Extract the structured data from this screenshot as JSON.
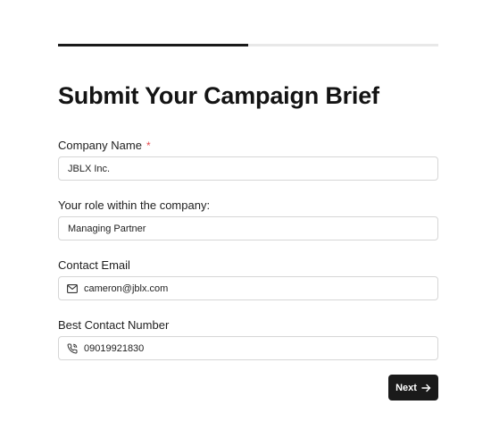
{
  "progress": {
    "fraction": 0.5
  },
  "form": {
    "title": "Submit Your Campaign Brief",
    "company_name": {
      "label": "Company Name",
      "required_mark": "*",
      "value": "JBLX Inc."
    },
    "role": {
      "label": "Your role within the company:",
      "value": "Managing Partner"
    },
    "email": {
      "label": "Contact Email",
      "icon": "mail-icon",
      "value": "cameron@jblx.com"
    },
    "phone": {
      "label": "Best Contact Number",
      "icon": "phone-icon",
      "value": "09019921830"
    },
    "next_button": {
      "label": "Next",
      "icon": "arrow-right-icon"
    }
  },
  "colors": {
    "accent": "#1a1a1a",
    "required": "#e5484d",
    "track": "#e8e8e8",
    "border": "#d6d6d6"
  }
}
